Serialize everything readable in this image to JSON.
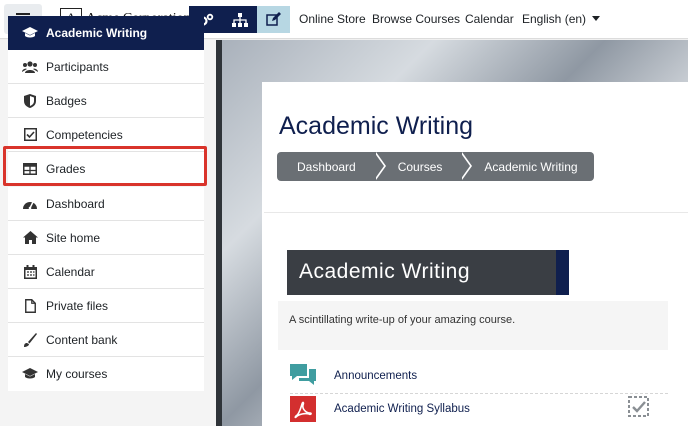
{
  "header": {
    "brand_letter": "A",
    "brand_name": "Acme Corporation",
    "nav": [
      "Online Store",
      "Browse Courses",
      "Calendar"
    ],
    "language": "English (en)",
    "icons": [
      "hamburger-icon",
      "cogs-icon",
      "sitemap-icon",
      "edit-icon"
    ]
  },
  "sidebar": {
    "course": "Academic Writing",
    "course_items": [
      {
        "label": "Participants",
        "icon": "users-icon"
      },
      {
        "label": "Badges",
        "icon": "shield-icon"
      },
      {
        "label": "Competencies",
        "icon": "checkbox-icon"
      },
      {
        "label": "Grades",
        "icon": "table-icon",
        "highlighted": true
      }
    ],
    "site_items": [
      {
        "label": "Dashboard",
        "icon": "tachometer-icon"
      },
      {
        "label": "Site home",
        "icon": "home-icon"
      },
      {
        "label": "Calendar",
        "icon": "calendar-icon"
      },
      {
        "label": "Private files",
        "icon": "file-icon"
      },
      {
        "label": "Content bank",
        "icon": "paint-brush-icon"
      },
      {
        "label": "My courses",
        "icon": "graduation-cap-icon"
      }
    ]
  },
  "main": {
    "title": "Academic Writing",
    "breadcrumb": [
      "Dashboard",
      "Courses",
      "Academic Writing"
    ],
    "banner_title": "Academic Writing",
    "summary": "A scintillating write-up of your amazing course.",
    "activities": [
      {
        "name": "Announcements",
        "icon": "forum-icon"
      },
      {
        "name": "Academic Writing Syllabus",
        "icon": "pdf-icon"
      }
    ]
  },
  "colors": {
    "navy": "#0f1f4e",
    "highlight": "#d9342b",
    "crumb": "#6a6f74"
  }
}
